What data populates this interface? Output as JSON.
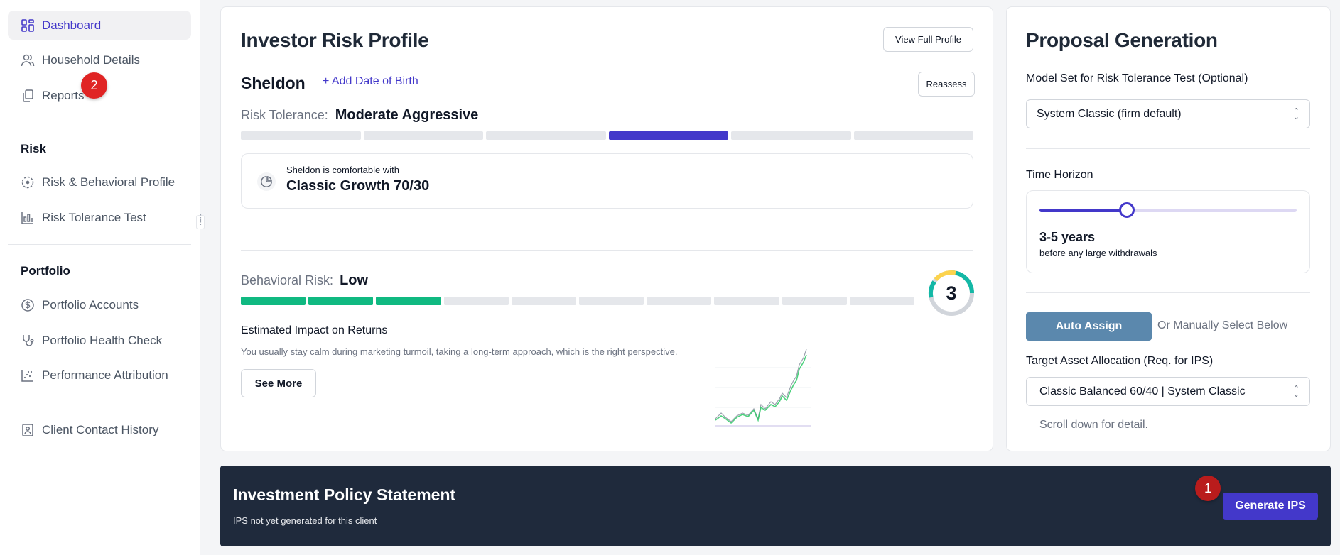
{
  "sidebar": {
    "items": [
      {
        "label": "Dashboard",
        "icon": "grid-icon",
        "active": true
      },
      {
        "label": "Household Details",
        "icon": "users-icon"
      },
      {
        "label": "Reports",
        "icon": "copy-icon"
      }
    ],
    "sections": [
      {
        "title": "Risk",
        "items": [
          {
            "label": "Risk & Behavioral Profile",
            "icon": "target-icon"
          },
          {
            "label": "Risk Tolerance Test",
            "icon": "bar-chart-icon"
          }
        ]
      },
      {
        "title": "Portfolio",
        "items": [
          {
            "label": "Portfolio Accounts",
            "icon": "dollar-circle-icon"
          },
          {
            "label": "Portfolio Health Check",
            "icon": "stethoscope-icon"
          },
          {
            "label": "Performance Attribution",
            "icon": "scatter-chart-icon"
          }
        ]
      }
    ],
    "footer_item": {
      "label": "Client Contact History",
      "icon": "contact-book-icon"
    }
  },
  "badges": {
    "reports_badge": "2",
    "generate_badge": "1"
  },
  "risk_profile": {
    "title": "Investor Risk Profile",
    "view_full_label": "View Full Profile",
    "client_name": "Sheldon",
    "add_dob_label": "+ Add Date of Birth",
    "reassess_label": "Reassess",
    "risk_tolerance_label": "Risk Tolerance:",
    "risk_tolerance_value": "Moderate Aggressive",
    "risk_tolerance_segments": 6,
    "risk_tolerance_level": 4,
    "comfort_caption": "Sheldon is comfortable with",
    "comfort_model": "Classic Growth 70/30",
    "behavioral_label": "Behavioral Risk:",
    "behavioral_value": "Low",
    "behavioral_segments": 10,
    "behavioral_level": 3,
    "behavioral_score": "3",
    "impact_title": "Estimated Impact on Returns",
    "impact_text": "You usually stay calm during marketing turmoil, taking a long-term approach, which is the right perspective.",
    "see_more_label": "See More"
  },
  "proposal": {
    "title": "Proposal Generation",
    "model_set_label": "Model Set for Risk Tolerance Test (Optional)",
    "model_set_value": "System Classic (firm default)",
    "time_horizon_label": "Time Horizon",
    "time_horizon_value": "3-5 years",
    "time_horizon_caption": "before any large withdrawals",
    "time_horizon_fraction": 0.34,
    "auto_assign_label": "Auto Assign",
    "manual_label": "Or Manually Select Below",
    "target_label": "Target Asset Allocation (Req. for IPS)",
    "target_value": "Classic Balanced 60/40 | System Classic",
    "scroll_hint": "Scroll down for detail."
  },
  "ips": {
    "title": "Investment Policy Statement",
    "subtitle": "IPS not yet generated for this client",
    "generate_label": "Generate IPS"
  },
  "colors": {
    "accent": "#4338ca",
    "teal": "#10b981",
    "auto_assign": "#5b88ad",
    "dark_bar": "#1f2a3c",
    "badge_red": "#e02424"
  }
}
